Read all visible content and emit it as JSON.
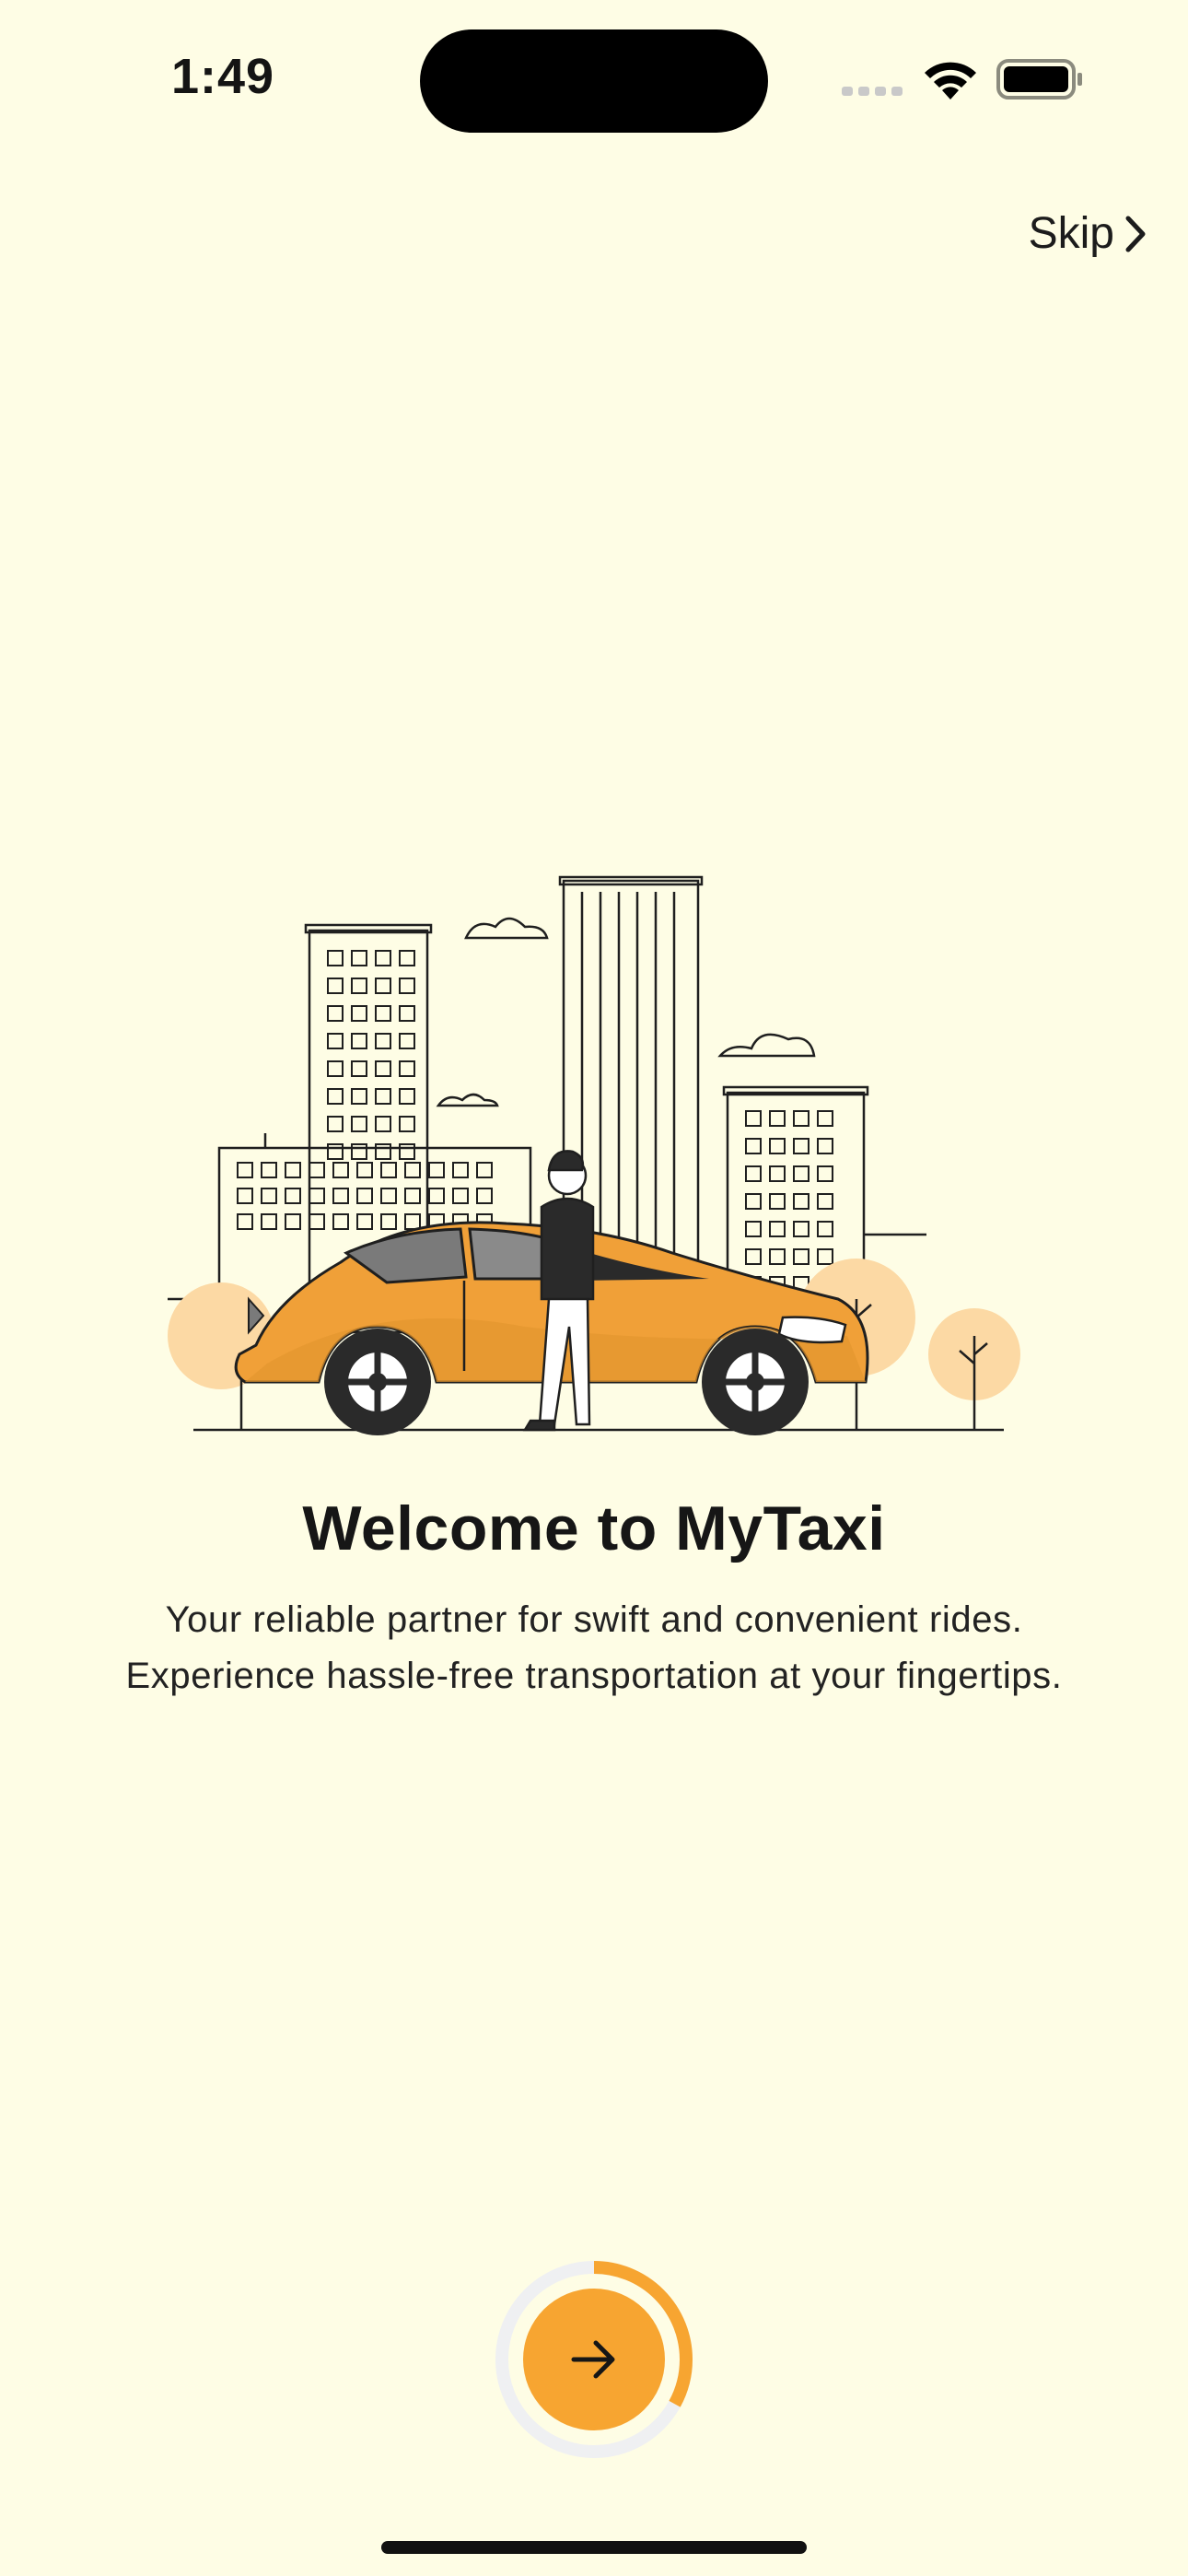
{
  "status_bar": {
    "time": "1:49"
  },
  "header": {
    "skip_label": "Skip",
    "skip_icon": "chevron-right-icon"
  },
  "onboarding": {
    "illustration": "taxi-city-illustration",
    "title": "Welcome to MyTaxi",
    "subtitle_line1": "Your reliable partner for swift and convenient rides.",
    "subtitle_line2": "Experience hassle-free transportation at your fingertips.",
    "progress_fraction": 0.33,
    "next_icon": "arrow-right-icon"
  },
  "colors": {
    "background": "#FEFDE5",
    "accent": "#F7A531",
    "progress_track": "#EFF0F2"
  }
}
